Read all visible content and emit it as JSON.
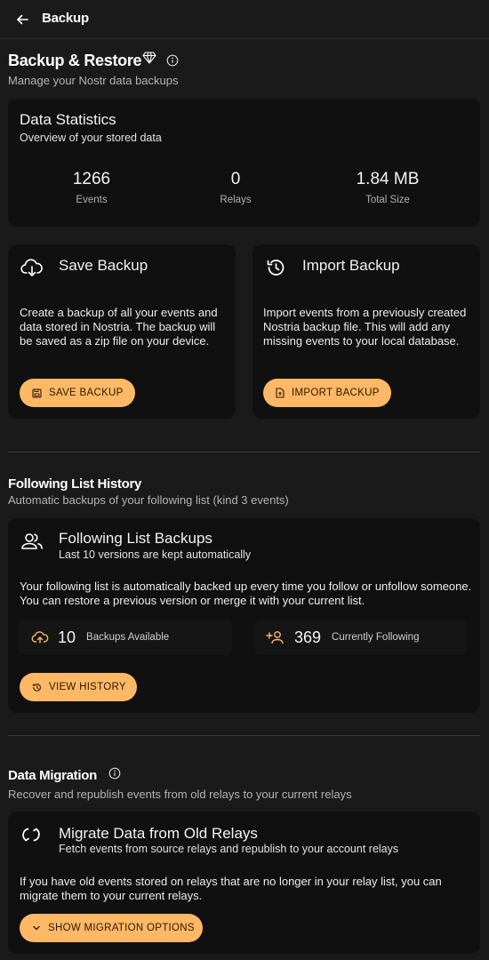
{
  "topbar": {
    "title": "Backup"
  },
  "backup_restore": {
    "title": "Backup & Restore",
    "subtitle": "Manage your Nostr data backups"
  },
  "stats": {
    "title": "Data Statistics",
    "subtitle": "Overview of your stored data",
    "items": [
      {
        "value": "1266",
        "label": "Events"
      },
      {
        "value": "0",
        "label": "Relays"
      },
      {
        "value": "1.84 MB",
        "label": "Total Size"
      }
    ]
  },
  "save_backup": {
    "title": "Save Backup",
    "description": "Create a backup of all your events and data stored in Nostria. The backup will be saved as a zip file on your device.",
    "button": "SAVE BACKUP"
  },
  "import_backup": {
    "title": "Import Backup",
    "description": "Import events from a previously created Nostria backup file. This will add any missing events to your local database.",
    "button": "IMPORT BACKUP"
  },
  "following_history": {
    "title": "Following List History",
    "subtitle": "Automatic backups of your following list (kind 3 events)",
    "card_title": "Following List Backups",
    "card_subtitle": "Last 10 versions are kept automatically",
    "description": "Your following list is automatically backed up every time you follow or unfollow someone. You can restore a previous version or merge it with your current list.",
    "backups_count": "10",
    "backups_label": "Backups Available",
    "following_count": "369",
    "following_label": "Currently Following",
    "button": "VIEW HISTORY"
  },
  "migration": {
    "title": "Data Migration",
    "subtitle": "Recover and republish events from old relays to your current relays",
    "card_title": "Migrate Data from Old Relays",
    "card_subtitle": "Fetch events from source relays and republish to your account relays",
    "description": "If you have old events stored on relays that are no longer in your relay list, you can migrate them to your current relays.",
    "button": "SHOW MIGRATION OPTIONS"
  },
  "colors": {
    "accent": "#ffb866",
    "background": "#1a1a1a",
    "card": "#101010"
  }
}
